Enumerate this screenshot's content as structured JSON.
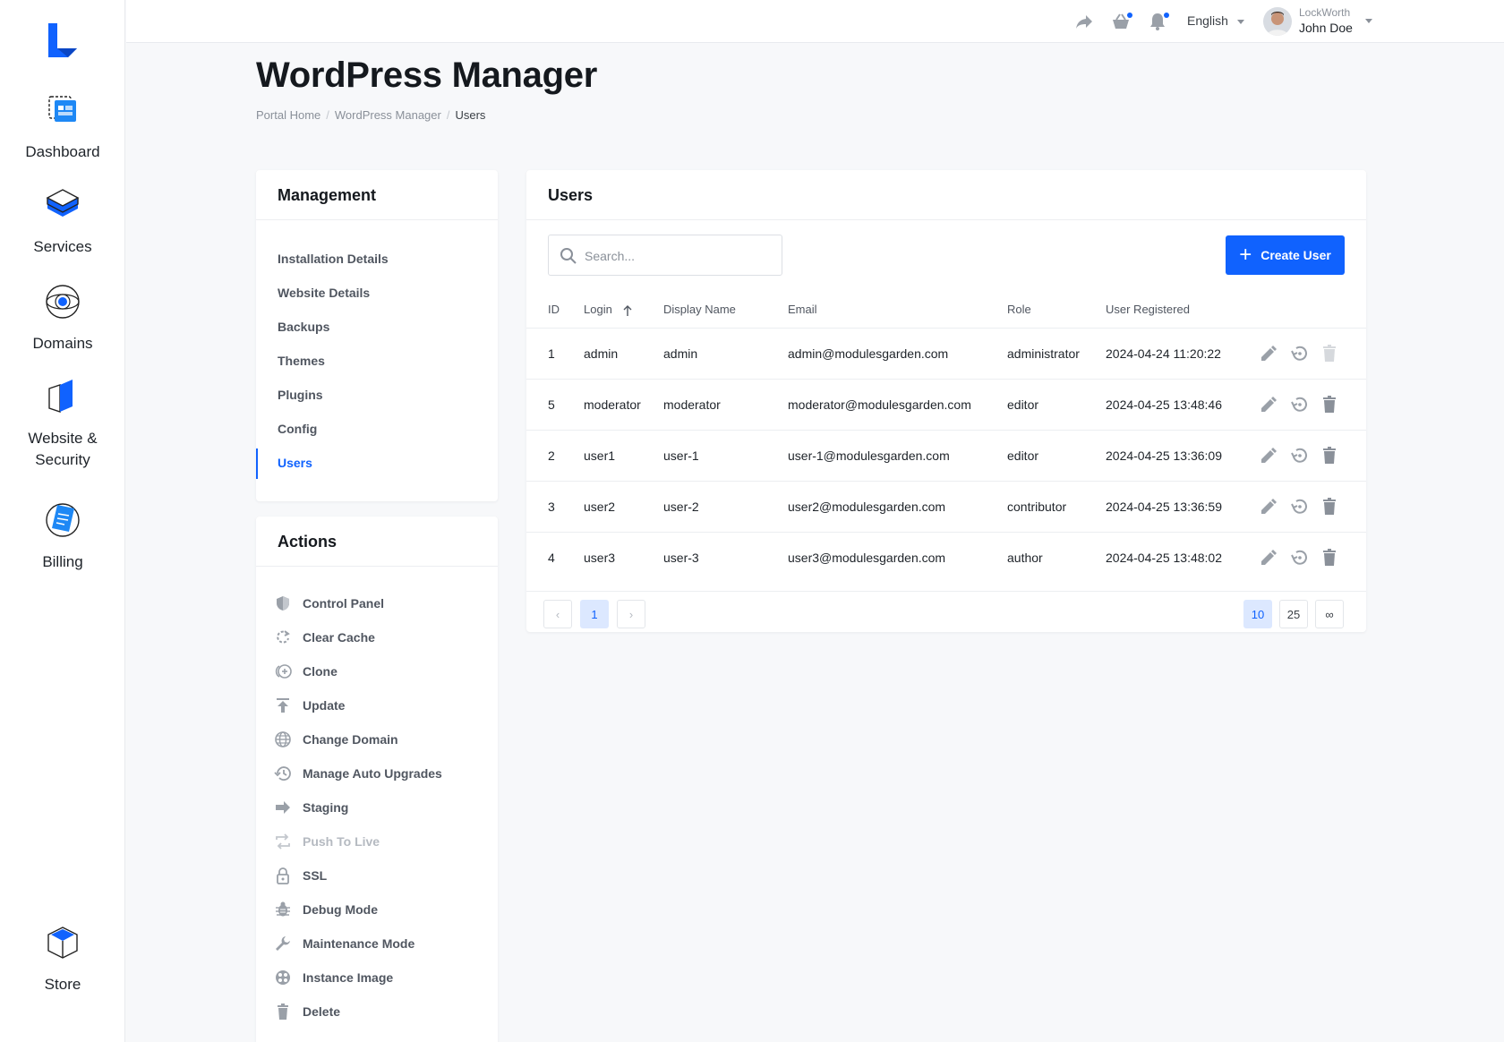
{
  "sidebar": {
    "items": [
      {
        "label": "Dashboard"
      },
      {
        "label": "Services"
      },
      {
        "label": "Domains"
      },
      {
        "label": "Website &"
      },
      {
        "label": "Security"
      },
      {
        "label": "Billing"
      },
      {
        "label": "Store"
      }
    ]
  },
  "topbar": {
    "language": "English",
    "company": "LockWorth",
    "user_name": "John Doe"
  },
  "header": {
    "title": "WordPress Manager",
    "breadcrumb": [
      "Portal Home",
      "WordPress Manager",
      "Users"
    ]
  },
  "management": {
    "title": "Management",
    "items": [
      "Installation Details",
      "Website Details",
      "Backups",
      "Themes",
      "Plugins",
      "Config",
      "Users"
    ],
    "active": "Users"
  },
  "actions": {
    "title": "Actions",
    "items": [
      {
        "label": "Control Panel",
        "icon": "shield-icon"
      },
      {
        "label": "Clear Cache",
        "icon": "refresh-icon"
      },
      {
        "label": "Clone",
        "icon": "clone-icon"
      },
      {
        "label": "Update",
        "icon": "upload-icon"
      },
      {
        "label": "Change Domain",
        "icon": "globe-icon"
      },
      {
        "label": "Manage Auto Upgrades",
        "icon": "history-icon"
      },
      {
        "label": "Staging",
        "icon": "arrow-right-icon"
      },
      {
        "label": "Push To Live",
        "icon": "swap-icon",
        "disabled": true
      },
      {
        "label": "SSL",
        "icon": "lock-icon"
      },
      {
        "label": "Debug Mode",
        "icon": "bug-icon"
      },
      {
        "label": "Maintenance Mode",
        "icon": "wrench-icon"
      },
      {
        "label": "Instance Image",
        "icon": "image-icon"
      },
      {
        "label": "Delete",
        "icon": "trash-icon"
      }
    ]
  },
  "users": {
    "title": "Users",
    "search_placeholder": "Search...",
    "create_label": "Create User",
    "columns": [
      "ID",
      "Login",
      "Display Name",
      "Email",
      "Role",
      "User Registered"
    ],
    "sort_column": "Login",
    "rows": [
      {
        "id": "1",
        "login": "admin",
        "display": "admin",
        "email": "admin@modulesgarden.com",
        "role": "administrator",
        "registered": "2024-04-24 11:20:22",
        "delete_disabled": true
      },
      {
        "id": "5",
        "login": "moderator",
        "display": "moderator",
        "email": "moderator@modulesgarden.com",
        "role": "editor",
        "registered": "2024-04-25 13:48:46"
      },
      {
        "id": "2",
        "login": "user1",
        "display": "user-1",
        "email": "user-1@modulesgarden.com",
        "role": "editor",
        "registered": "2024-04-25 13:36:09"
      },
      {
        "id": "3",
        "login": "user2",
        "display": "user-2",
        "email": "user2@modulesgarden.com",
        "role": "contributor",
        "registered": "2024-04-25 13:36:59"
      },
      {
        "id": "4",
        "login": "user3",
        "display": "user-3",
        "email": "user3@modulesgarden.com",
        "role": "author",
        "registered": "2024-04-25 13:48:02"
      }
    ],
    "pagination": {
      "prev": "‹",
      "current_page": "1",
      "next": "›",
      "page_sizes": [
        "10",
        "25",
        "∞"
      ],
      "active_size": "10"
    }
  },
  "colors": {
    "accent": "#1062fe",
    "text": "#1e2329",
    "muted": "#8a9099"
  }
}
